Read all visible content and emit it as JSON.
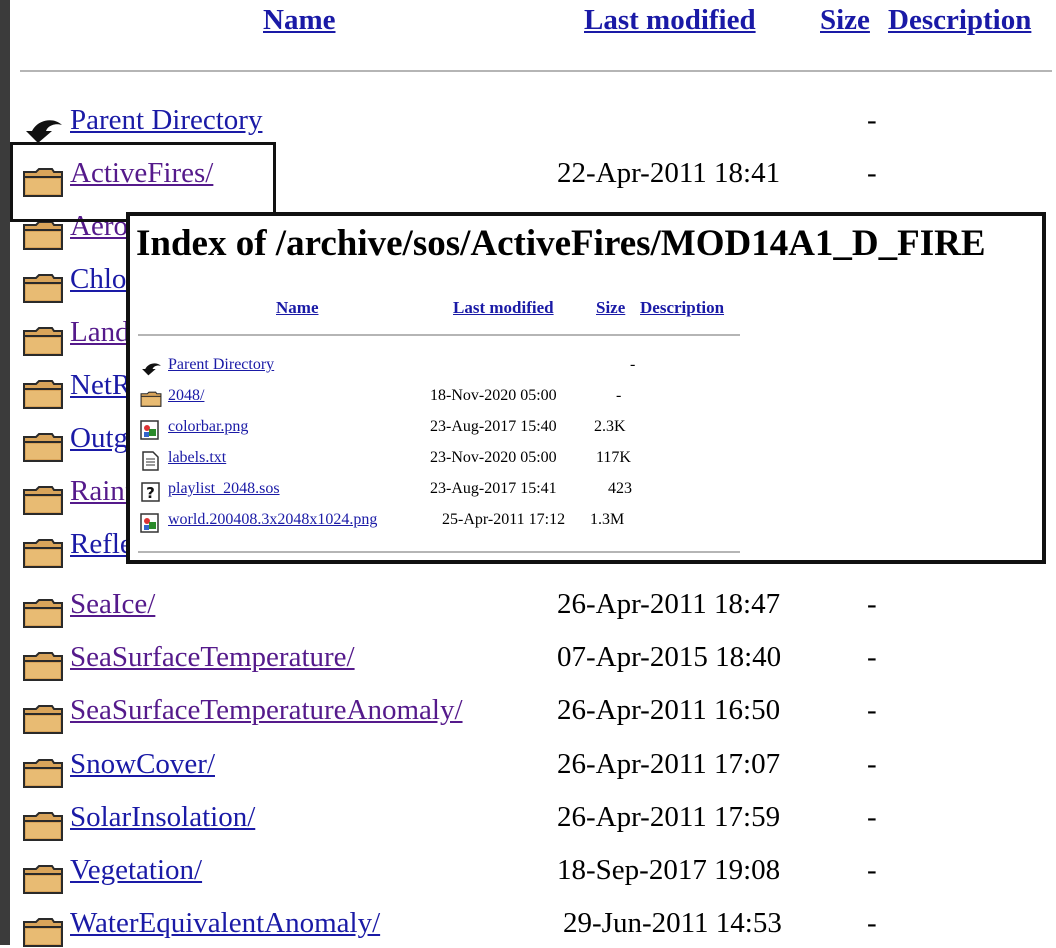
{
  "headers": {
    "name": "Name",
    "last_modified": "Last modified",
    "size": "Size",
    "description": "Description"
  },
  "entries": [
    {
      "name": "Parent Directory",
      "date": "",
      "size": "-",
      "icon": "back-arrow-icon"
    },
    {
      "name": "ActiveFires/",
      "date": "22-Apr-2011 18:41",
      "size": "-",
      "icon": "folder-icon"
    },
    {
      "name": "Aerosol/",
      "date": "",
      "size": "",
      "icon": "folder-icon"
    },
    {
      "name": "Chlorophyll/",
      "date": "",
      "size": "",
      "icon": "folder-icon"
    },
    {
      "name": "LandCover/",
      "date": "",
      "size": "",
      "icon": "folder-icon"
    },
    {
      "name": "NetRadiation/",
      "date": "",
      "size": "",
      "icon": "folder-icon"
    },
    {
      "name": "OutgoingLongwave/",
      "date": "",
      "size": "",
      "icon": "folder-icon"
    },
    {
      "name": "Rainfall/",
      "date": "",
      "size": "",
      "icon": "folder-icon"
    },
    {
      "name": "Reflectance/",
      "date": "",
      "size": "",
      "icon": "folder-icon"
    },
    {
      "name": "SeaIce/",
      "date": "26-Apr-2011 18:47",
      "size": "-",
      "icon": "folder-icon"
    },
    {
      "name": "SeaSurfaceTemperature/",
      "date": "07-Apr-2015 18:40",
      "size": "-",
      "icon": "folder-icon"
    },
    {
      "name": "SeaSurfaceTemperatureAnomaly/",
      "date": "26-Apr-2011 16:50",
      "size": "-",
      "icon": "folder-icon"
    },
    {
      "name": "SnowCover/",
      "date": "26-Apr-2011 17:07",
      "size": "-",
      "icon": "folder-icon"
    },
    {
      "name": "SolarInsolation/",
      "date": "26-Apr-2011 17:59",
      "size": "-",
      "icon": "folder-icon"
    },
    {
      "name": "Vegetation/",
      "date": "18-Sep-2017 19:08",
      "size": "-",
      "icon": "folder-icon"
    },
    {
      "name": "WaterEquivalentAnomaly/",
      "date": "29-Jun-2011 14:53",
      "size": "-",
      "icon": "folder-icon"
    }
  ],
  "popup": {
    "title": "Index of /archive/sos/ActiveFires/MOD14A1_D_FIRE",
    "headers": {
      "name": "Name",
      "last_modified": "Last modified",
      "size": "Size",
      "description": "Description"
    },
    "entries": [
      {
        "name": "Parent Directory",
        "date": "",
        "size": "-",
        "icon": "back-arrow-icon"
      },
      {
        "name": "2048/",
        "date": "18-Nov-2020 05:00",
        "size": "-",
        "icon": "folder-icon"
      },
      {
        "name": "colorbar.png",
        "date": "23-Aug-2017 15:40",
        "size": "2.3K",
        "icon": "image-file-icon"
      },
      {
        "name": "labels.txt",
        "date": "23-Nov-2020 05:00",
        "size": "117K",
        "icon": "text-file-icon"
      },
      {
        "name": "playlist_2048.sos",
        "date": "23-Aug-2017 15:41",
        "size": "423",
        "icon": "unknown-file-icon"
      },
      {
        "name": "world.200408.3x2048x1024.png",
        "date": "25-Apr-2011 17:12",
        "size": "1.3M",
        "icon": "image-file-icon"
      }
    ]
  }
}
